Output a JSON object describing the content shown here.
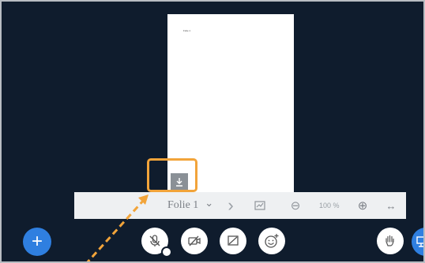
{
  "presentation": {
    "slide_text": "Folie 1",
    "current_slide_label": "Folie 1",
    "zoom_label": "100 %"
  },
  "toolbar": {
    "dropdown_glyph": "⌄",
    "next_glyph": "›",
    "zoom_out_glyph": "⊖",
    "zoom_in_glyph": "⊕",
    "fit_width_glyph": "↔"
  },
  "actions": {
    "plus_glyph": "+"
  },
  "colors": {
    "background": "#0f1c2d",
    "accent_blue": "#2f7fe0",
    "highlight_orange": "#f2a43a"
  },
  "icons": [
    "download-icon",
    "chevron-down-icon",
    "chevron-right-icon",
    "whiteboard-icon",
    "zoom-out-icon",
    "zoom-in-icon",
    "fit-width-icon",
    "plus-icon",
    "mic-muted-icon",
    "camera-off-icon",
    "screen-share-off-icon",
    "emoji-icon",
    "raise-hand-icon",
    "presentation-icon"
  ]
}
